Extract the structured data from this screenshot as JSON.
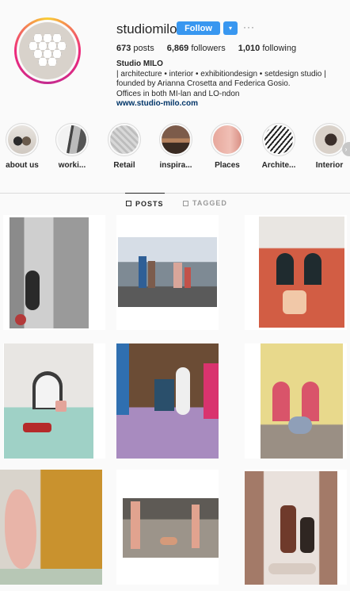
{
  "profile": {
    "username": "studiomilo",
    "follow_label": "Follow",
    "dropdown_glyph": "▾",
    "more_glyph": "···",
    "stats": {
      "posts_count": "673",
      "posts_label": "posts",
      "followers_count": "6,869",
      "followers_label": "followers",
      "following_count": "1,010",
      "following_label": "following"
    },
    "bio": {
      "name": "Studio MILO",
      "line1": "| architecture • interior • exhibitiondesign • setdesign studio |",
      "line2": "founded by Arianna Crosetta and Federica Gosio.",
      "line3": "Offices in both MI-lan and LO-ndon",
      "link": "www.studio-milo.com"
    },
    "accent": "#3897f0"
  },
  "highlights": [
    {
      "label": "about us"
    },
    {
      "label": "worki..."
    },
    {
      "label": "Retail"
    },
    {
      "label": "inspira..."
    },
    {
      "label": "Places"
    },
    {
      "label": "Archite..."
    },
    {
      "label": "Interior"
    }
  ],
  "tabs": {
    "posts": "POSTS",
    "tagged": "TAGGED"
  },
  "arrow_glyph": "›"
}
